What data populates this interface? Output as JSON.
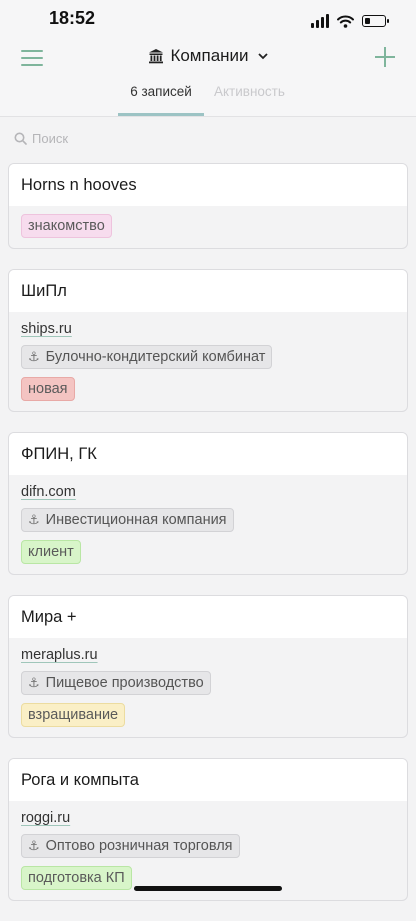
{
  "status_bar": {
    "time": "18:52"
  },
  "nav": {
    "title": "Компании",
    "tabs": [
      {
        "label": "6 записей",
        "active": true
      },
      {
        "label": "Активность",
        "active": false
      }
    ]
  },
  "search": {
    "placeholder": "Поиск"
  },
  "cards": [
    {
      "name": "Horns n hooves",
      "tag": "знакомство",
      "tag_color": "#f7dcee",
      "tag_border": "#eec3dd"
    },
    {
      "name": "ШиПл",
      "domain": "ships.ru",
      "industry": "Булочно-кондитерский комбинат",
      "tag": "новая",
      "tag_color": "#f4c4c2",
      "tag_border": "#e8a9a6"
    },
    {
      "name": "ФПИН, ГК",
      "domain": "difn.com",
      "industry": "Инвестиционная компания",
      "tag": "клиент",
      "tag_color": "#d8f5c9",
      "tag_border": "#b9e6a4"
    },
    {
      "name": "Мира +",
      "domain": "meraplus.ru",
      "industry": "Пищевое производство",
      "tag": "взращивание",
      "tag_color": "#faefc6",
      "tag_border": "#ecdca0"
    },
    {
      "name": "Рога и компыта",
      "domain": "roggi.ru",
      "industry": "Оптово розничная торговля",
      "tag": "подготовка КП",
      "tag_color": "#d8f5c9",
      "tag_border": "#b9e6a4"
    }
  ],
  "colors": {
    "accent": "#7fb59c",
    "tab_underline": "#9cc3c4"
  }
}
